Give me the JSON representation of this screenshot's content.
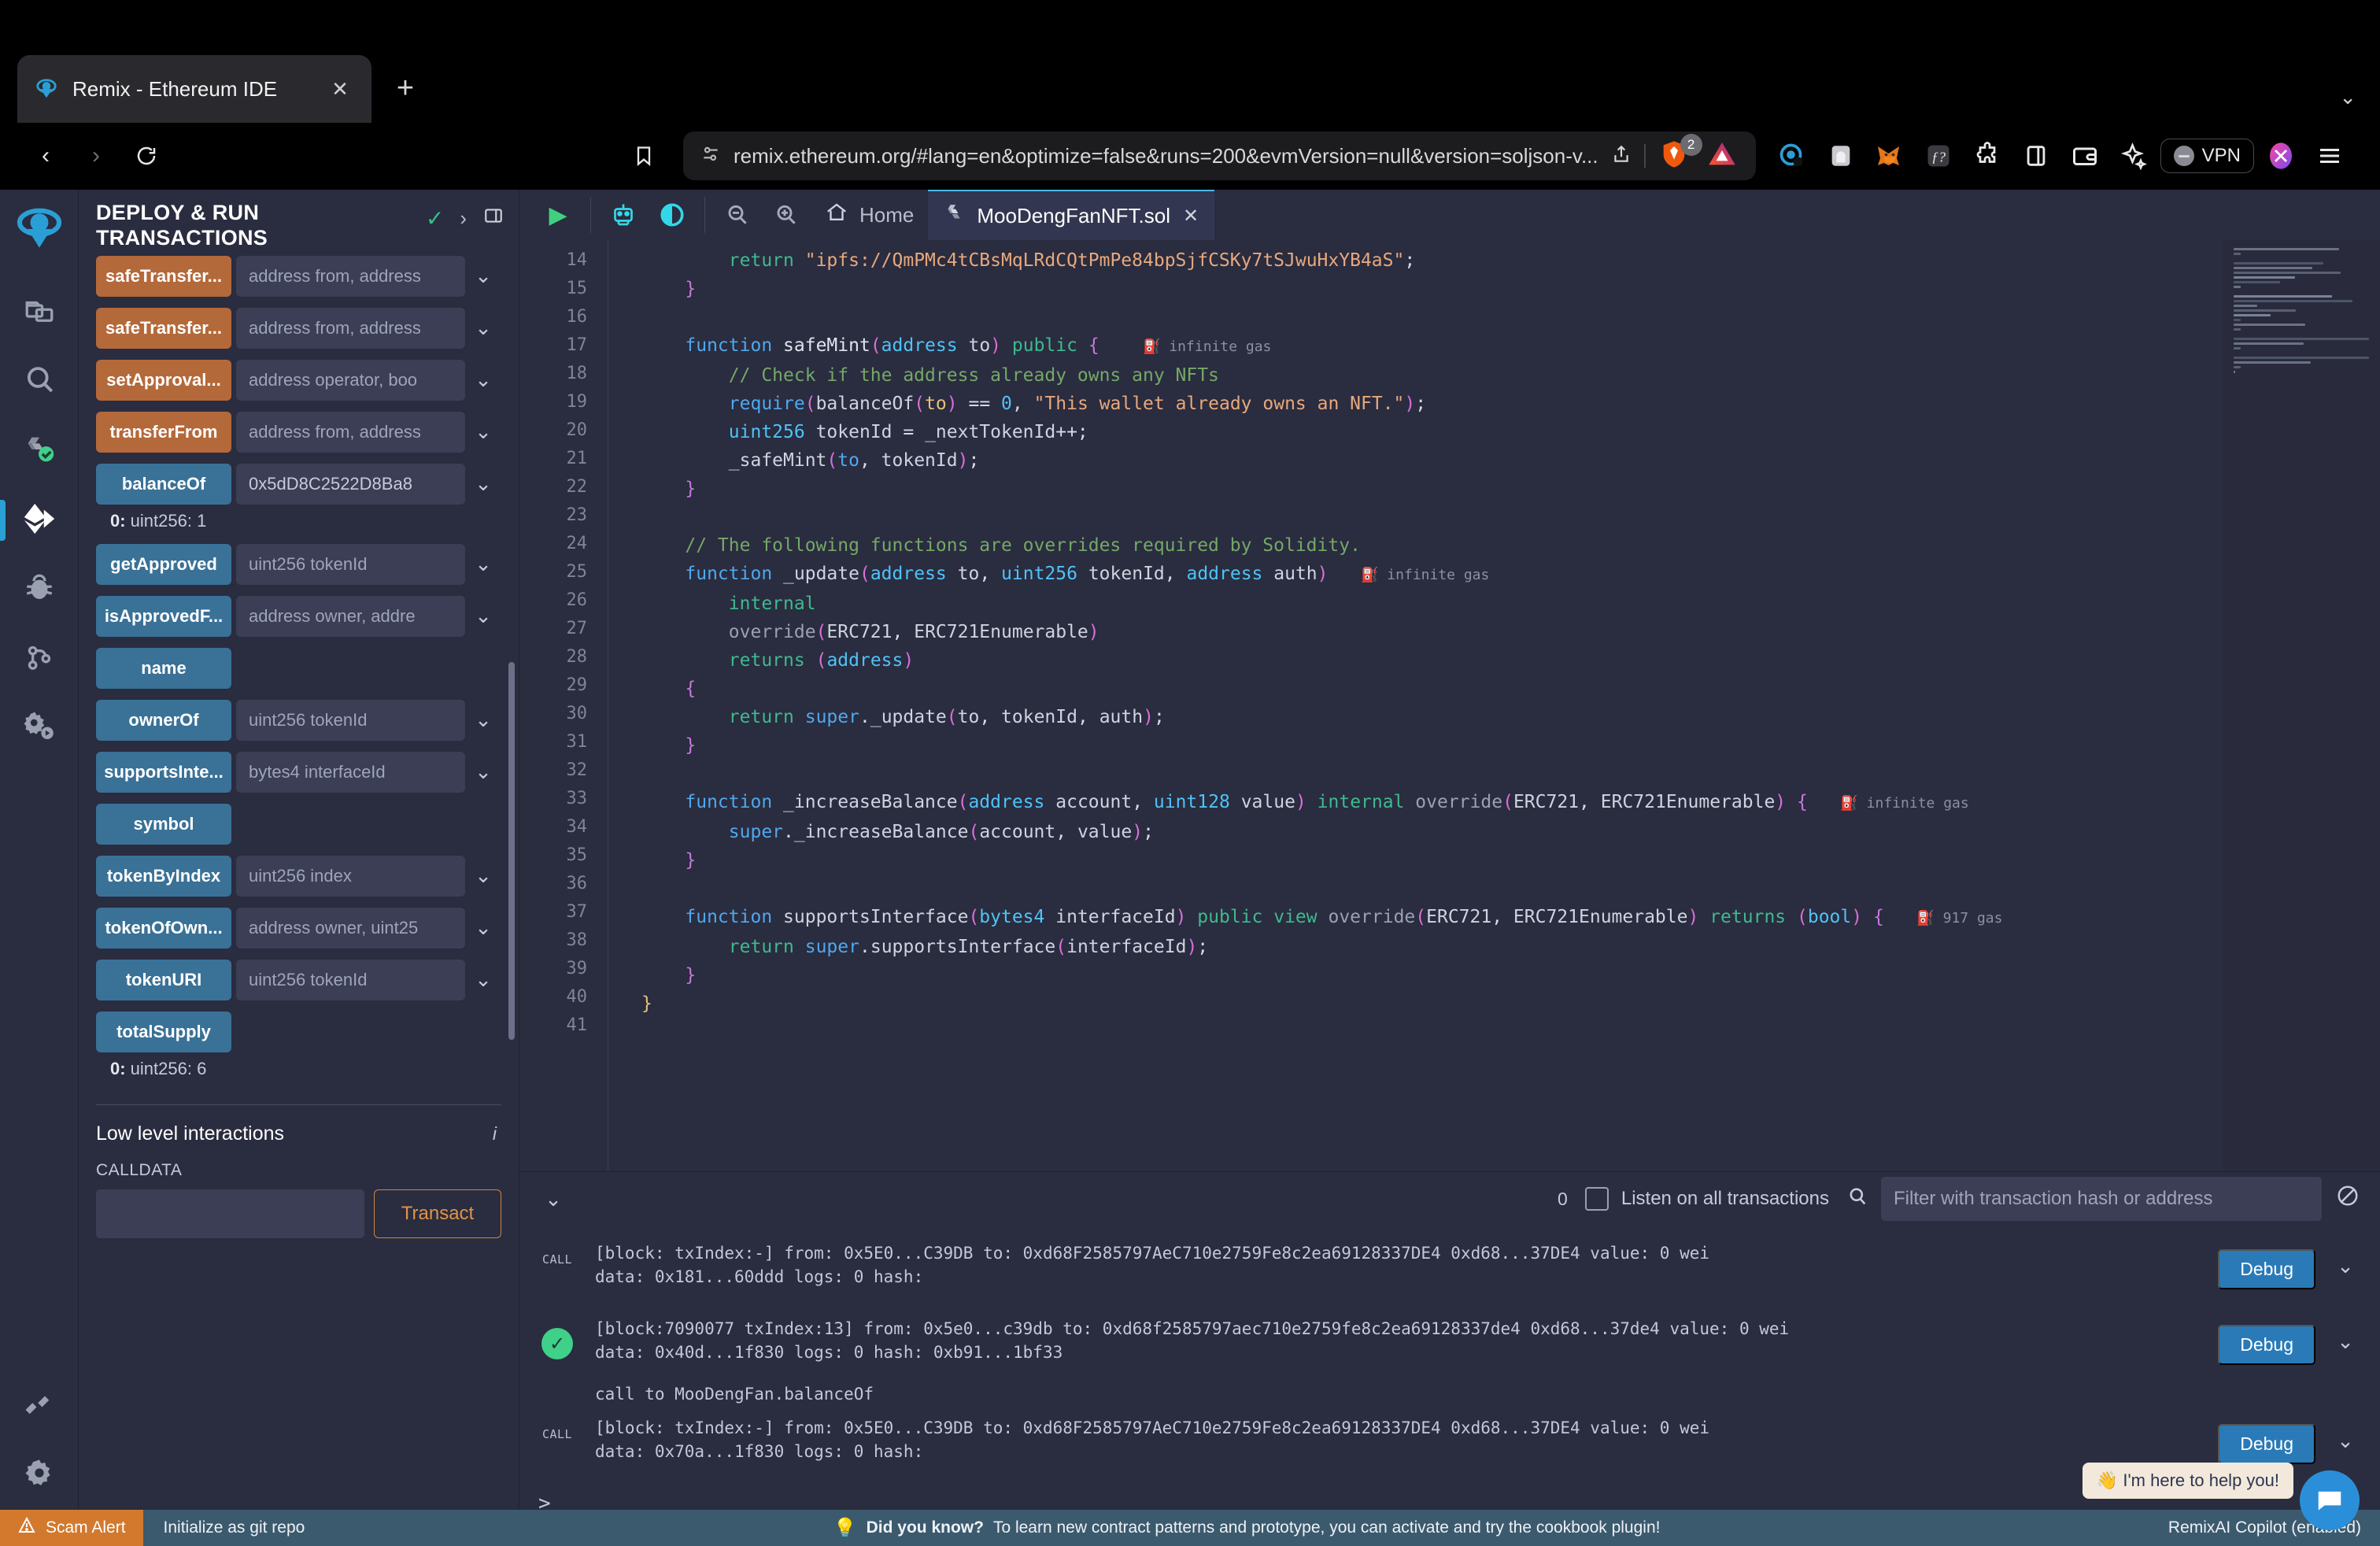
{
  "browser": {
    "tab": {
      "title": "Remix - Ethereum IDE",
      "favicon": "remix-logo-icon",
      "close_label": "✕"
    },
    "new_tab_label": "+",
    "tabstrip_chevron": "⌄",
    "nav": {
      "back": "‹",
      "forward": "›",
      "reload": "↻",
      "bookmark": "bookmark-icon"
    },
    "url": "remix.ethereum.org/#lang=en&optimize=false&runs=200&evmVersion=null&version=soljson-v...",
    "share_icon": "share-icon",
    "brave_shield_count": "2",
    "extensions": [
      "brave-rewards-icon",
      "fingerprint-icon",
      "metamask-icon",
      "phantom-icon",
      "puzzle-extension-icon",
      "sidebar-icon",
      "wallet-icon",
      "leo-ai-icon"
    ],
    "vpn_label": "VPN",
    "profile_icon": "profile-avatar-icon",
    "menu_icon": "hamburger-menu-icon"
  },
  "icon_bar": {
    "logo": "remix-logo-icon",
    "items": [
      {
        "name": "file-explorer",
        "icon": "files-icon",
        "active": false
      },
      {
        "name": "search",
        "icon": "magnifier-icon",
        "active": false
      },
      {
        "name": "solidity-compiler",
        "icon": "solidity-check-icon",
        "active": false
      },
      {
        "name": "deploy-and-run",
        "icon": "ethereum-arrow-icon",
        "active": true
      },
      {
        "name": "debugger",
        "icon": "bug-icon",
        "active": false
      },
      {
        "name": "git",
        "icon": "git-branch-icon",
        "active": false
      },
      {
        "name": "plugin-manager",
        "icon": "gear-play-icon",
        "active": false
      }
    ]
  },
  "side_panel": {
    "title": "DEPLOY & RUN TRANSACTIONS",
    "header_icons": [
      "check-icon",
      "chevron-right-icon",
      "split-panel-icon"
    ],
    "functions": [
      {
        "label": "safeTransfer...",
        "kind": "orange",
        "input": "address from, address",
        "has_chevron": true,
        "result": null
      },
      {
        "label": "safeTransfer...",
        "kind": "orange",
        "input": "address from, address",
        "has_chevron": true,
        "result": null
      },
      {
        "label": "setApproval...",
        "kind": "orange",
        "input": "address operator, boo",
        "has_chevron": true,
        "result": null
      },
      {
        "label": "transferFrom",
        "kind": "orange",
        "input": "address from, address",
        "has_chevron": true,
        "result": null
      },
      {
        "label": "balanceOf",
        "kind": "blue",
        "input": "0x5dD8C2522D8Ba8",
        "input_is_value": true,
        "has_chevron": true,
        "result": "0: uint256: 1",
        "result_key": "0:",
        "result_val": "uint256: 1"
      },
      {
        "label": "getApproved",
        "kind": "blue",
        "input": "uint256 tokenId",
        "has_chevron": true,
        "result": null
      },
      {
        "label": "isApprovedF...",
        "kind": "blue",
        "input": "address owner, addre",
        "has_chevron": true,
        "result": null
      },
      {
        "label": "name",
        "kind": "blue",
        "input": "",
        "has_chevron": false,
        "result": null
      },
      {
        "label": "ownerOf",
        "kind": "blue",
        "input": "uint256 tokenId",
        "has_chevron": true,
        "result": null
      },
      {
        "label": "supportsInte...",
        "kind": "blue",
        "input": "bytes4 interfaceId",
        "has_chevron": true,
        "result": null
      },
      {
        "label": "symbol",
        "kind": "blue",
        "input": "",
        "has_chevron": false,
        "result": null
      },
      {
        "label": "tokenByIndex",
        "kind": "blue",
        "input": "uint256 index",
        "has_chevron": true,
        "result": null
      },
      {
        "label": "tokenOfOwn...",
        "kind": "blue",
        "input": "address owner, uint25",
        "has_chevron": true,
        "result": null
      },
      {
        "label": "tokenURI",
        "kind": "blue",
        "input": "uint256 tokenId",
        "has_chevron": true,
        "result": null
      },
      {
        "label": "totalSupply",
        "kind": "blue",
        "input": "",
        "has_chevron": false,
        "result": "0: uint256: 6",
        "result_key": "0:",
        "result_val": "uint256: 6"
      }
    ],
    "low_level": {
      "title": "Low level interactions",
      "info_icon": "info-icon",
      "calldata_label": "CALLDATA",
      "calldata_value": "",
      "transact_label": "Transact"
    }
  },
  "editor": {
    "toolbar": {
      "run_icon": "run-play-icon",
      "copilot_icon": "robot-icon",
      "contrast_icon": "contrast-icon",
      "zoom_out_icon": "zoom-out-icon",
      "zoom_in_icon": "zoom-in-icon",
      "home_icon": "home-icon",
      "home_label": "Home"
    },
    "tab": {
      "icon": "solidity-file-icon",
      "label": "MooDengFanNFT.sol",
      "close": "✕"
    },
    "first_line_number": 14,
    "lines": [
      {
        "n": 14,
        "html": "        <span class='ky'>return</span> <span class='st'>\"ipfs://QmPMc4tCBsMqLRdCQtPmPe84bpSjfCSKy7tSJwuHxYB4aS\"</span>;"
      },
      {
        "n": 15,
        "html": "    <span class='pn2'>}</span>"
      },
      {
        "n": 16,
        "html": ""
      },
      {
        "n": 17,
        "html": "    <span class='k'>function</span> <span class='fn'>safeMint</span><span class='pn'>(</span><span class='ty'>address</span> <span class='wh'>to</span><span class='pn'>)</span> <span class='ky'>public</span> <span class='pn2'>{</span>    <span class='gas-tag'>⛽ infinite gas</span>"
      },
      {
        "n": 18,
        "html": "        <span class='cm'>// Check if the address already owns any NFTs</span>"
      },
      {
        "n": 19,
        "html": "        <span class='k'>require</span><span class='pn'>(</span><span class='wh'>balanceOf</span><span class='pn'>(</span><span class='yl'>to</span><span class='pn'>)</span> == <span class='ty'>0</span>, <span class='st'>\"This wallet already owns an NFT.\"</span><span class='pn'>)</span>;"
      },
      {
        "n": 20,
        "html": "        <span class='ty'>uint256</span> <span class='wh'>tokenId</span> = <span class='wh'>_nextTokenId</span>++;"
      },
      {
        "n": 21,
        "html": "        <span class='wh'>_safeMint</span><span class='pn'>(</span><span class='k'>to</span>, <span class='wh'>tokenId</span><span class='pn'>)</span>;"
      },
      {
        "n": 22,
        "html": "    <span class='pn2'>}</span>"
      },
      {
        "n": 23,
        "html": ""
      },
      {
        "n": 24,
        "html": "    <span class='cm'>// The following functions are overrides required by Solidity.</span>"
      },
      {
        "n": 25,
        "html": "    <span class='k'>function</span> <span class='wh'>_update</span><span class='pn'>(</span><span class='ty'>address</span> <span class='wh'>to</span>, <span class='ty'>uint256</span> <span class='wh'>tokenId</span>, <span class='ty'>address</span> <span class='wh'>auth</span><span class='pn'>)</span>   <span class='gas-tag'>⛽ infinite gas</span>"
      },
      {
        "n": 26,
        "html": "        <span class='ky'>internal</span>"
      },
      {
        "n": 27,
        "html": "        <span class='gy'>override</span><span class='pn'>(</span><span class='wh'>ERC721</span>, <span class='wh'>ERC721Enumerable</span><span class='pn'>)</span>"
      },
      {
        "n": 28,
        "html": "        <span class='ky'>returns</span> <span class='pn'>(</span><span class='ty'>address</span><span class='pn'>)</span>"
      },
      {
        "n": 29,
        "html": "    <span class='pn2'>{</span>"
      },
      {
        "n": 30,
        "html": "        <span class='ky'>return</span> <span class='k'>super</span>.<span class='wh'>_update</span><span class='pn'>(</span><span class='wh'>to</span>, <span class='wh'>tokenId</span>, <span class='wh'>auth</span><span class='pn'>)</span>;"
      },
      {
        "n": 31,
        "html": "    <span class='pn2'>}</span>"
      },
      {
        "n": 32,
        "html": ""
      },
      {
        "n": 33,
        "html": "    <span class='k'>function</span> <span class='wh'>_increaseBalance</span><span class='pn'>(</span><span class='ty'>address</span> <span class='wh'>account</span>, <span class='ty'>uint128</span> <span class='wh'>value</span><span class='pn'>)</span> <span class='ky'>internal</span> <span class='gy'>override</span><span class='pn'>(</span><span class='wh'>ERC721</span>, <span class='wh'>ERC721Enumerable</span><span class='pn'>)</span> <span class='pn2'>{</span>   <span class='gas-tag'>⛽ infinite gas</span>"
      },
      {
        "n": 34,
        "html": "        <span class='k'>super</span>.<span class='wh'>_increaseBalance</span><span class='pn'>(</span><span class='wh'>account</span>, <span class='wh'>value</span><span class='pn'>)</span>;"
      },
      {
        "n": 35,
        "html": "    <span class='pn2'>}</span>"
      },
      {
        "n": 36,
        "html": ""
      },
      {
        "n": 37,
        "html": "    <span class='k'>function</span> <span class='wh'>supportsInterface</span><span class='pn'>(</span><span class='ty'>bytes4</span> <span class='wh'>interfaceId</span><span class='pn'>)</span> <span class='ky'>public view</span> <span class='gy'>override</span><span class='pn'>(</span><span class='wh'>ERC721</span>, <span class='wh'>ERC721Enumerable</span><span class='pn'>)</span> <span class='ky'>returns</span> <span class='pn'>(</span><span class='ty'>bool</span><span class='pn'>)</span> <span class='pn2'>{</span>   <span class='gas-tag'>⛽ 917 gas</span>"
      },
      {
        "n": 38,
        "html": "        <span class='ky'>return</span> <span class='k'>super</span>.<span class='wh'>supportsInterface</span><span class='pn'>(</span><span class='wh'>interfaceId</span><span class='pn'>)</span>;"
      },
      {
        "n": 39,
        "html": "    <span class='pn2'>}</span>"
      },
      {
        "n": 40,
        "html": "<span class='nm'>}</span>"
      },
      {
        "n": 41,
        "html": ""
      }
    ]
  },
  "terminal": {
    "toolbar": {
      "collapse_icon": "chevron-double-down-icon",
      "count": "0",
      "listen_checkbox": false,
      "listen_label": "Listen on all transactions",
      "search_icon": "search-icon",
      "filter_placeholder": "Filter with transaction hash or address",
      "clear_icon": "no-entry-icon"
    },
    "transactions": [
      {
        "badge": "CALL",
        "status": "call",
        "line1": "[block: txIndex:-] from: 0x5E0...C39DB to: 0xd68F2585797AeC710e2759Fe8c2ea69128337DE4 0xd68...37DE4 value: 0 wei",
        "line2": "data: 0x181...60ddd logs: 0 hash:",
        "debug_label": "Debug",
        "note": null
      },
      {
        "badge": "check",
        "status": "success",
        "line1": "[block:7090077 txIndex:13] from: 0x5e0...c39db to: 0xd68f2585797aec710e2759fe8c2ea69128337de4 0xd68...37de4 value: 0 wei",
        "line2": "data: 0x40d...1f830 logs: 0 hash: 0xb91...1bf33",
        "debug_label": "Debug",
        "note": "call to MooDengFan.balanceOf"
      },
      {
        "badge": "CALL",
        "status": "call",
        "line1": "[block: txIndex:-] from: 0x5E0...C39DB to: 0xd68F2585797AeC710e2759Fe8c2ea69128337DE4 0xd68...37DE4 value: 0 wei",
        "line2": "data: 0x70a...1f830 logs: 0 hash:",
        "debug_label": "Debug",
        "note": null
      }
    ],
    "prompt": ">",
    "help_bubble": "👋 I'm here to help you!",
    "chat_icon": "chat-bubble-icon"
  },
  "status_bar": {
    "scam_alert": "Scam Alert",
    "scam_icon": "warning-triangle-icon",
    "git_label": "Initialize as git repo",
    "tip_icon": "lightbulb-icon",
    "tip_prefix": "Did you know?",
    "tip_text": "To learn new contract patterns and prototype, you can activate and try the cookbook plugin!",
    "right_label": "RemixAI Copilot (enabled)"
  },
  "colors": {
    "accent_blue": "#2a9fd6",
    "orange": "#b4693a",
    "blue_btn": "#3a7197",
    "success_green": "#3fd08a",
    "status_bar": "#3c5a6e",
    "scam_orange": "#d2792e"
  }
}
